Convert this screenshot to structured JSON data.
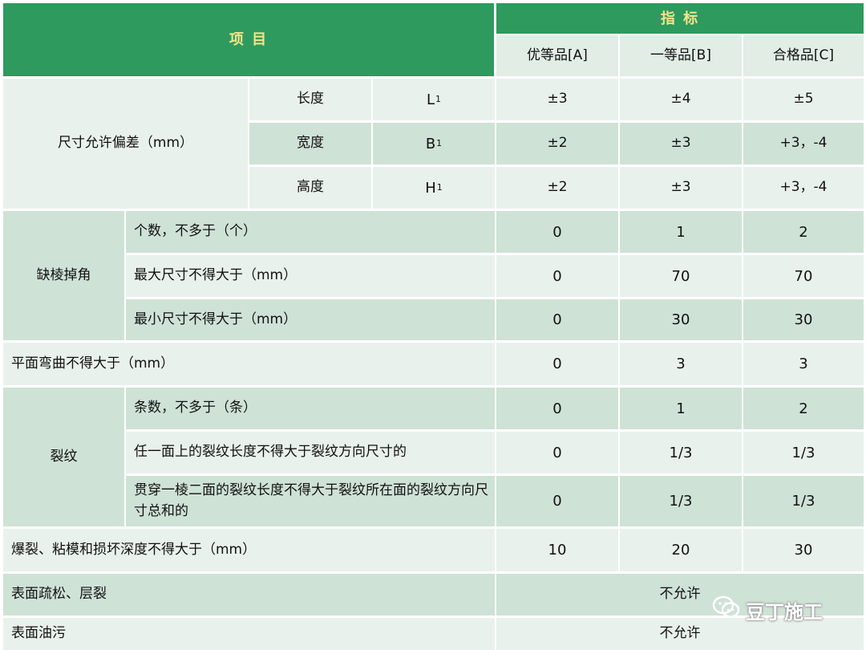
{
  "header": {
    "item": "项 目",
    "index": "指 标",
    "grades": [
      "优等品[A]",
      "一等品[B]",
      "合格品[C]"
    ]
  },
  "size_tolerance": {
    "label": "尺寸允许偏差（mm）",
    "rows": [
      {
        "name": "长度",
        "sym": "L",
        "sub": "1",
        "a": "±3",
        "b": "±4",
        "c": "±5"
      },
      {
        "name": "宽度",
        "sym": "B",
        "sub": "1",
        "a": "±2",
        "b": "±3",
        "c": "+3，-4"
      },
      {
        "name": "高度",
        "sym": "H",
        "sub": "1",
        "a": "±2",
        "b": "±3",
        "c": "+3，-4"
      }
    ]
  },
  "corner_defect": {
    "label": "缺棱掉角",
    "rows": [
      {
        "desc": "个数，不多于（个）",
        "a": "0",
        "b": "1",
        "c": "2"
      },
      {
        "desc": "最大尺寸不得大于（mm）",
        "a": "0",
        "b": "70",
        "c": "70"
      },
      {
        "desc": "最小尺寸不得大于（mm）",
        "a": "0",
        "b": "30",
        "c": "30"
      }
    ]
  },
  "flatness": {
    "desc": "平面弯曲不得大于（mm）",
    "a": "0",
    "b": "3",
    "c": "3"
  },
  "cracks": {
    "label": "裂纹",
    "rows": [
      {
        "desc": "条数，不多于（条）",
        "a": "0",
        "b": "1",
        "c": "2"
      },
      {
        "desc": "任一面上的裂纹长度不得大于裂纹方向尺寸的",
        "a": "0",
        "b": "1/3",
        "c": "1/3"
      },
      {
        "desc": "贯穿一棱二面的裂纹长度不得大于裂纹所在面的裂纹方向尺寸总和的",
        "a": "0",
        "b": "1/3",
        "c": "1/3"
      }
    ]
  },
  "burst": {
    "desc": "爆裂、粘模和损坏深度不得大于（mm）",
    "a": "10",
    "b": "20",
    "c": "30"
  },
  "surface_loose": {
    "desc": "表面疏松、层裂",
    "value": "不允许"
  },
  "surface_oil": {
    "desc": "表面油污",
    "value": "不允许"
  },
  "watermark": {
    "text": "豆丁施工",
    "icon": "wechat-icon"
  }
}
